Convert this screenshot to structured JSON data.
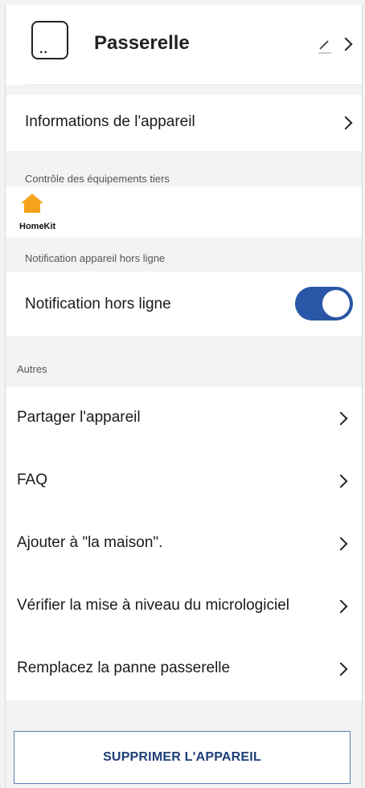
{
  "header": {
    "title": "Passerelle",
    "device_icon_text": ".."
  },
  "info_row": {
    "label": "Informations de l'appareil"
  },
  "third_party": {
    "section_label": "Contrôle des équipements tiers",
    "homekit_label": "HomeKit"
  },
  "offline": {
    "section_label": "Notification appareil hors ligne",
    "toggle_label": "Notification hors ligne",
    "toggle_on": true
  },
  "others": {
    "section_label": "Autres",
    "items": [
      {
        "label": "Partager l'appareil"
      },
      {
        "label": "FAQ"
      },
      {
        "label": "Ajouter à \"la maison\"."
      },
      {
        "label": "Vérifier la mise à niveau du micrologiciel"
      },
      {
        "label": "Remplacez la panne passerelle"
      }
    ]
  },
  "delete_button": {
    "label": "SUPPRIMER L'APPAREIL"
  },
  "colors": {
    "accent": "#2a56a8",
    "homekit": "#f5a31a",
    "background": "#f3f3f3"
  }
}
